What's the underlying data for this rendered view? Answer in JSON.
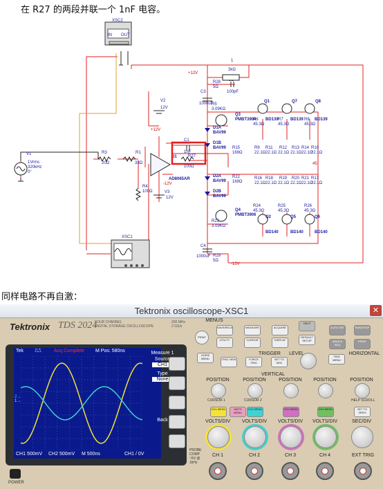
{
  "captions": {
    "top": "在 R27 的两段并联一个 1nF 电容。",
    "middle": "同样电路不再自激："
  },
  "schematic": {
    "xsc2": "XSC2",
    "xsc2_in": "IN",
    "xsc2_out": "OUT",
    "xsc1": "XSC1",
    "v1": "V1",
    "v1_value": "1Vrms",
    "v1_freq": "320kHz",
    "v1_phase": "0°",
    "r3": "R3",
    "r3_value": "20Ω",
    "r1": "R1",
    "r1_value": "33Ω",
    "r4": "R4",
    "r4_value": "100Ω",
    "v2": "V2",
    "v2_value": "12V",
    "v3": "V3",
    "v3_value": "12V",
    "plus12a": "+12V",
    "plus12b": "+12V",
    "minus12a": "-12V",
    "minus12b": "-12V",
    "u1": "U1",
    "u1_part": "AD8065AR",
    "c1": "C1",
    "c1_value": "1nF",
    "r27": "R27",
    "r27_value": "100Ω",
    "c2": "C2",
    "c2_value": "100pF",
    "r1b": "1",
    "r1b_value": "3kΩ",
    "r28": "R28",
    "r28_value": "5Ω",
    "c3": "C3",
    "c3_value": "1000uF",
    "r5": "R5",
    "r5_value": "3.09KΩ",
    "c4": "C4",
    "c4_value": "1000uF",
    "r29": "R29",
    "r29_value": "5Ω",
    "r23": "R23",
    "r23_value": "3.09KΩ",
    "q3": "Q3",
    "q3_part": "PMBT3904",
    "q4": "Q4",
    "q4_part": "PMBT3906",
    "d1a": "D1A",
    "d1b": "D1B",
    "d2a": "D2A",
    "d2b": "D2B",
    "diode_part": "BAV99",
    "r15": "R15",
    "r22": "R22",
    "r1516_value": "169Ω",
    "q1": "Q1",
    "q7": "Q7",
    "q8": "Q8",
    "q2": "Q2",
    "q5": "Q5",
    "q6": "Q6",
    "bd139": "BD139",
    "bd140": "BD140",
    "r6": "R6",
    "r7": "R7",
    "r8": "R8",
    "r24": "R24",
    "r25": "R25",
    "r26": "R26",
    "r_emitter_value": "45.3Ω",
    "r9": "R9",
    "r11": "R11",
    "r12": "R12",
    "r13": "R13",
    "r14": "R14",
    "r10": "R10",
    "r16": "R16",
    "r18": "R18",
    "r19": "R19",
    "r20": "R20",
    "r21": "R21",
    "r17": "R17",
    "r_out_value": "22.1Ω",
    "node45": "45"
  },
  "oscilloscope": {
    "window_title": "Tektronix oscilloscope-XSC1",
    "close": "✕",
    "brand": "Tektronix",
    "model": "TDS 2024",
    "model_sub1": "FOUR CHANNEL",
    "model_sub2": "DIGITAL STORAGE OSCILLOSCOPE",
    "spec1": "200 MHz",
    "spec2": "2 GS/s",
    "screen": {
      "tek": "Tek",
      "status": "Acq Complete",
      "mpos": "M Pos: 580ns",
      "ch1_scale": "CH1 500mV",
      "ch2_scale": "CH2 500mV",
      "time_scale": "M 500ns",
      "trigger": "CH1 / 0V",
      "menu_title": "Measure 1",
      "menu_source_label": "Source",
      "menu_source_value": "CH1",
      "menu_type_label": "Type",
      "menu_type_value": "None",
      "menu_back": "Back",
      "marker1": "1→",
      "marker2": "2→"
    },
    "buttons": {
      "print": "PRINT",
      "save_recall": "SAVE/RECALL",
      "measure": "MEASURE",
      "acquire": "ACQUIRE",
      "help": "HELP",
      "auto_set": "AUTO SET",
      "utility": "UTILITY",
      "cursor": "CURSOR",
      "display": "DISPLAY",
      "default_setup": "DEFAULT SETUP",
      "single_seq": "SINGLE SEQ",
      "run_stop": "RUN/STOP",
      "print_btn": "PRINT",
      "trig_menu": "TRIG MENU",
      "set_50": "SET TO 50%",
      "force_trig": "FORCE TRIG",
      "trig_view": "TRIG VIEW",
      "horiz_menu": "HORIZ MENU",
      "set_to_zero": "SET TO ZERO",
      "ch1_menu": "CH1 MENU",
      "math_menu": "MATH MENU",
      "ch2_menu": "CH2 MENU",
      "ch3_menu": "CH3 MENU",
      "ch4_menu": "CH4 MENU",
      "power": "POWER"
    },
    "labels": {
      "menus": "MENUS",
      "trigger": "TRIGGER",
      "level": "LEVEL",
      "vertical": "VERTICAL",
      "horizontal": "HORIZONTAL",
      "position": "POSITION",
      "volts_div": "VOLTS/DIV",
      "sec_div": "SEC/DIV",
      "cursor1": "CURSOR 1",
      "cursor2": "CURSOR 2",
      "user_select": "USER SELECT",
      "help_scroll": "HELP SCROLL",
      "ch1": "CH 1",
      "ch2": "CH 2",
      "ch3": "CH 3",
      "ch4": "CH 4",
      "ext_trig": "EXT TRIG",
      "probe_comp": "PROBE COMP ~5V @ 1kHz"
    },
    "colors": {
      "ch1": "#f4e23a",
      "ch2": "#3fd2d2",
      "screen": "#0a1a8c",
      "status_red": "#ff3030"
    }
  }
}
